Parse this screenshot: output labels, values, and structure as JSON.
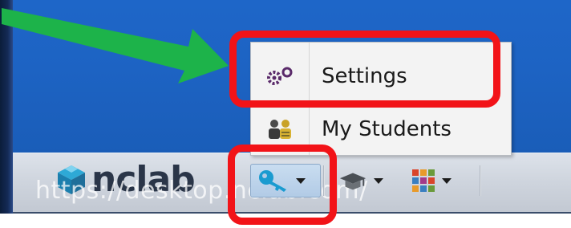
{
  "menu": {
    "items": [
      {
        "label": "Settings",
        "icon": "gears-icon"
      },
      {
        "label": "My Students",
        "icon": "students-icon"
      }
    ]
  },
  "taskbar": {
    "logo_text": "nclab",
    "url_overlay": "https://desktop.nclab.com/",
    "buttons": [
      {
        "name": "key-menu-button",
        "icon": "key-icon"
      },
      {
        "name": "hat-menu-button",
        "icon": "graduation-hat-icon"
      },
      {
        "name": "apps-menu-button",
        "icon": "apps-grid-icon"
      }
    ]
  },
  "annotations": {
    "highlight_color": "#f21318",
    "arrow_color": "#1db34a"
  },
  "colors": {
    "desktop_blue": "#1d63c3",
    "taskbar_gray": "#cfd5de",
    "menu_bg": "#f3f3f3",
    "key_teal": "#1a9bd0"
  }
}
